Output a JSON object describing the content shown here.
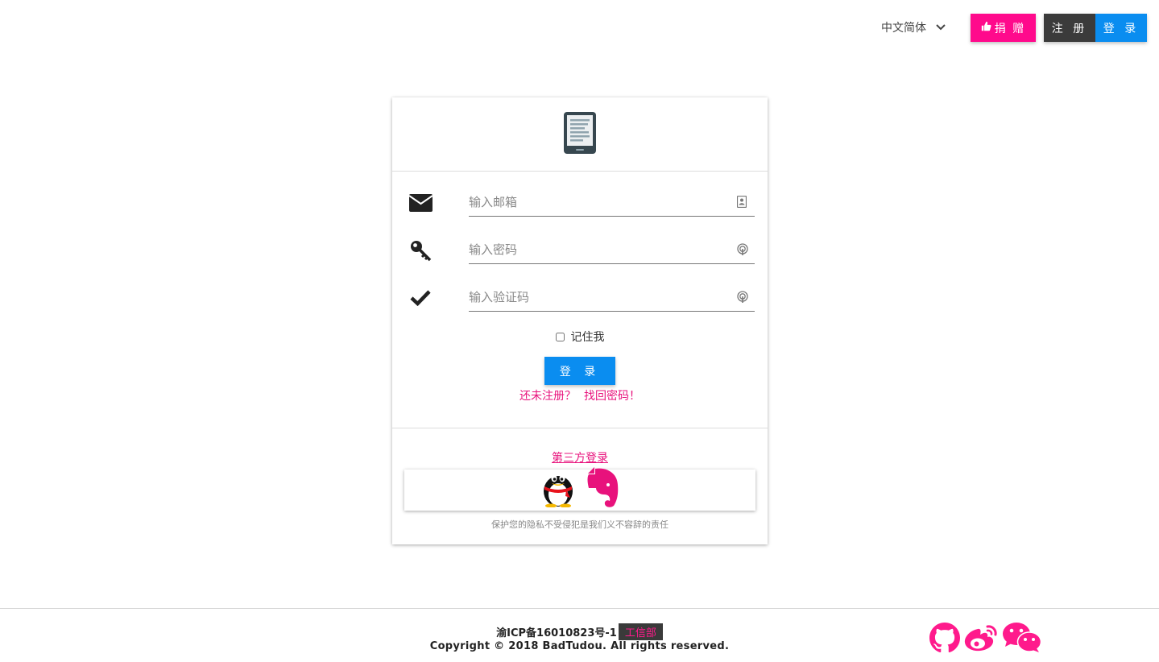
{
  "header": {
    "language": "中文简体",
    "donate_label": "捐 赠",
    "register_label": "注 册",
    "login_label": "登 录"
  },
  "form": {
    "email_placeholder": "输入邮箱",
    "password_placeholder": "输入密码",
    "captcha_placeholder": "输入验证码",
    "remember_label": "记住我",
    "submit_label": "登 录",
    "not_registered_link": "还未注册？",
    "forgot_password_link": "找回密码！"
  },
  "third_party": {
    "title": "第三方登录",
    "providers": [
      "qq-icon",
      "evernote-icon"
    ],
    "privacy_note": "保护您的隐私不受侵犯是我们义不容辞的责任"
  },
  "footer": {
    "icp": "渝ICP备16010823号-1",
    "icp_badge": "工信部",
    "copyright": "Copyright © 2018 BadTudou. All rights reserved.",
    "social_icons": [
      "github-icon",
      "weibo-icon",
      "wechat-icon"
    ]
  },
  "colors": {
    "accent_pink": "#ff0a8c",
    "primary_blue": "#0a8df0",
    "dark": "#3b3b3b"
  }
}
